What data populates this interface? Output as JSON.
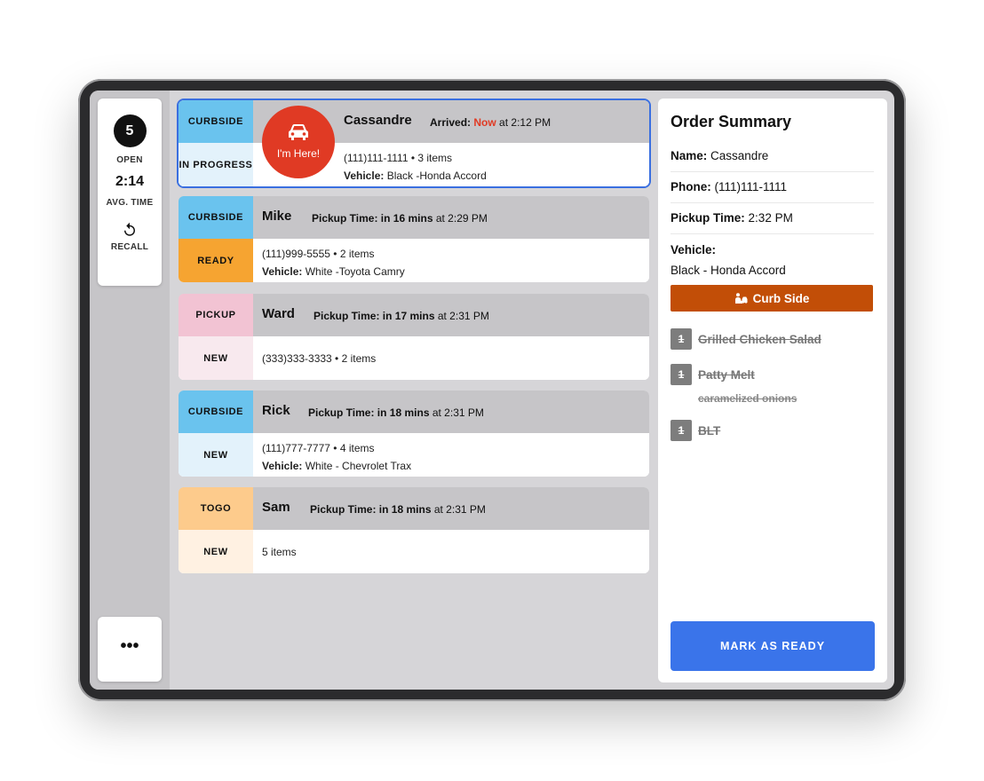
{
  "stats": {
    "open_count": "5",
    "open_label": "OPEN",
    "avg_time": "2:14",
    "avg_time_label": "AVG. TIME",
    "recall_label": "RECALL",
    "more_label": "•••"
  },
  "orders": [
    {
      "type": "CURBSIDE",
      "status": "IN PROGRESS",
      "name": "Cassandre",
      "time_prefix": "Arrived:",
      "time_highlight": "Now",
      "time_suffix": "at 2:12 PM",
      "phone_items": "(111)111-1111 • 3 items",
      "vehicle_label": "Vehicle:",
      "vehicle": "Black -Honda Accord",
      "badge": "I'm Here!"
    },
    {
      "type": "CURBSIDE",
      "status": "READY",
      "name": "Mike",
      "time_prefix": "Pickup Time: in 16 mins",
      "time_suffix": "at 2:29 PM",
      "phone_items": "(111)999-5555 • 2 items",
      "vehicle_label": "Vehicle:",
      "vehicle": "White -Toyota Camry"
    },
    {
      "type": "PICKUP",
      "status": "NEW",
      "name": "Ward",
      "time_prefix": "Pickup Time: in 17 mins",
      "time_suffix": "at 2:31 PM",
      "phone_items": "(333)333-3333 • 2 items"
    },
    {
      "type": "CURBSIDE",
      "status": "NEW",
      "name": "Rick",
      "time_prefix": "Pickup Time: in 18 mins",
      "time_suffix": "at 2:31 PM",
      "phone_items": "(111)777-7777 • 4 items",
      "vehicle_label": "Vehicle:",
      "vehicle": "White - Chevrolet Trax"
    },
    {
      "type": "TOGO",
      "status": "NEW",
      "name": "Sam",
      "time_prefix": "Pickup Time: in 18 mins",
      "time_suffix": "at 2:31 PM",
      "phone_items": "5 items"
    }
  ],
  "summary": {
    "title": "Order Summary",
    "name_label": "Name:",
    "name": "Cassandre",
    "phone_label": "Phone:",
    "phone": "(111)111-1111",
    "pickup_label": "Pickup Time:",
    "pickup_time": "2:32 PM",
    "vehicle_label": "Vehicle:",
    "vehicle": "Black - Honda Accord",
    "curb_side_label": "Curb Side",
    "items": [
      {
        "qty": "1",
        "name": "Grilled Chicken Salad"
      },
      {
        "qty": "1",
        "name": "Patty Melt",
        "modifier": "caramelized onions"
      },
      {
        "qty": "1",
        "name": "BLT"
      }
    ],
    "mark_ready_label": "MARK AS READY"
  },
  "colors": {
    "curbside": "#6ac3ee",
    "curbside_light": "#e3f2fb",
    "ready": "#f6a431",
    "pickup": "#f2c3d3",
    "pickup_light": "#f8e9ee",
    "togo": "#fdcb8c",
    "togo_light": "#fff1e2",
    "alert_red": "#e03a24",
    "accent_blue": "#3a74ea",
    "curb_orange": "#c24e07"
  }
}
